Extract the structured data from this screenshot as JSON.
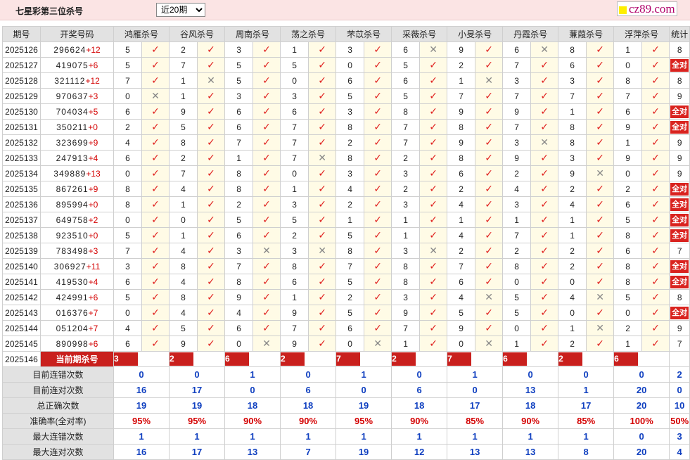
{
  "header": {
    "title": "七星彩第三位杀号",
    "period_selected": "近20期",
    "brand": "cz89.com"
  },
  "table": {
    "col_issue": "期号",
    "col_prize": "开奖号码",
    "col_stats": "统计",
    "experts": [
      "鸿雁杀号",
      "谷风杀号",
      "周南杀号",
      "荡之杀号",
      "芣苡杀号",
      "采薇杀号",
      "小旻杀号",
      "丹霞杀号",
      "蒹葭杀号",
      "浮萍杀号"
    ],
    "rows": [
      {
        "issue": "2025126",
        "prize": "296624",
        "sum": "+12",
        "kills": [
          "5",
          "2",
          "3",
          "1",
          "3",
          "6",
          "9",
          "6",
          "8",
          "1"
        ],
        "ok": [
          1,
          1,
          1,
          1,
          1,
          0,
          1,
          0,
          1,
          1
        ],
        "stat": "8"
      },
      {
        "issue": "2025127",
        "prize": "419075",
        "sum": "+6",
        "kills": [
          "5",
          "7",
          "5",
          "5",
          "0",
          "5",
          "2",
          "7",
          "6",
          "0"
        ],
        "ok": [
          1,
          1,
          1,
          1,
          1,
          1,
          1,
          1,
          1,
          1
        ],
        "stat": "全对"
      },
      {
        "issue": "2025128",
        "prize": "321112",
        "sum": "+12",
        "kills": [
          "7",
          "1",
          "5",
          "0",
          "6",
          "6",
          "1",
          "3",
          "3",
          "8"
        ],
        "ok": [
          1,
          0,
          1,
          1,
          1,
          1,
          0,
          1,
          1,
          1
        ],
        "stat": "8"
      },
      {
        "issue": "2025129",
        "prize": "970637",
        "sum": "+3",
        "kills": [
          "0",
          "1",
          "3",
          "3",
          "5",
          "5",
          "7",
          "7",
          "7",
          "7"
        ],
        "ok": [
          0,
          1,
          1,
          1,
          1,
          1,
          1,
          1,
          1,
          1
        ],
        "stat": "9"
      },
      {
        "issue": "2025130",
        "prize": "704034",
        "sum": "+5",
        "kills": [
          "6",
          "9",
          "6",
          "6",
          "3",
          "8",
          "9",
          "9",
          "1",
          "6"
        ],
        "ok": [
          1,
          1,
          1,
          1,
          1,
          1,
          1,
          1,
          1,
          1
        ],
        "stat": "全对"
      },
      {
        "issue": "2025131",
        "prize": "350211",
        "sum": "+0",
        "kills": [
          "2",
          "5",
          "6",
          "7",
          "8",
          "7",
          "8",
          "7",
          "8",
          "9"
        ],
        "ok": [
          1,
          1,
          1,
          1,
          1,
          1,
          1,
          1,
          1,
          1
        ],
        "stat": "全对"
      },
      {
        "issue": "2025132",
        "prize": "323699",
        "sum": "+9",
        "kills": [
          "4",
          "8",
          "7",
          "7",
          "2",
          "7",
          "9",
          "3",
          "8",
          "1"
        ],
        "ok": [
          1,
          1,
          1,
          1,
          1,
          1,
          1,
          0,
          1,
          1
        ],
        "stat": "9"
      },
      {
        "issue": "2025133",
        "prize": "247913",
        "sum": "+4",
        "kills": [
          "6",
          "2",
          "1",
          "7",
          "8",
          "2",
          "8",
          "9",
          "3",
          "9"
        ],
        "ok": [
          1,
          1,
          1,
          0,
          1,
          1,
          1,
          1,
          1,
          1
        ],
        "stat": "9"
      },
      {
        "issue": "2025134",
        "prize": "349889",
        "sum": "+13",
        "kills": [
          "0",
          "7",
          "8",
          "0",
          "3",
          "3",
          "6",
          "2",
          "9",
          "0"
        ],
        "ok": [
          1,
          1,
          1,
          1,
          1,
          1,
          1,
          1,
          0,
          1
        ],
        "stat": "9"
      },
      {
        "issue": "2025135",
        "prize": "867261",
        "sum": "+9",
        "kills": [
          "8",
          "4",
          "8",
          "1",
          "4",
          "2",
          "2",
          "4",
          "2",
          "2"
        ],
        "ok": [
          1,
          1,
          1,
          1,
          1,
          1,
          1,
          1,
          1,
          1
        ],
        "stat": "全对"
      },
      {
        "issue": "2025136",
        "prize": "895994",
        "sum": "+0",
        "kills": [
          "8",
          "1",
          "2",
          "3",
          "2",
          "3",
          "4",
          "3",
          "4",
          "6"
        ],
        "ok": [
          1,
          1,
          1,
          1,
          1,
          1,
          1,
          1,
          1,
          1
        ],
        "stat": "全对"
      },
      {
        "issue": "2025137",
        "prize": "649758",
        "sum": "+2",
        "kills": [
          "0",
          "0",
          "5",
          "5",
          "1",
          "1",
          "1",
          "1",
          "1",
          "5"
        ],
        "ok": [
          1,
          1,
          1,
          1,
          1,
          1,
          1,
          1,
          1,
          1
        ],
        "stat": "全对"
      },
      {
        "issue": "2025138",
        "prize": "923510",
        "sum": "+0",
        "kills": [
          "5",
          "1",
          "6",
          "2",
          "5",
          "1",
          "4",
          "7",
          "1",
          "8"
        ],
        "ok": [
          1,
          1,
          1,
          1,
          1,
          1,
          1,
          1,
          1,
          1
        ],
        "stat": "全对"
      },
      {
        "issue": "2025139",
        "prize": "783498",
        "sum": "+3",
        "kills": [
          "7",
          "4",
          "3",
          "3",
          "8",
          "3",
          "2",
          "2",
          "2",
          "6"
        ],
        "ok": [
          1,
          1,
          0,
          0,
          1,
          0,
          1,
          1,
          1,
          1
        ],
        "stat": "7"
      },
      {
        "issue": "2025140",
        "prize": "306927",
        "sum": "+11",
        "kills": [
          "3",
          "8",
          "7",
          "8",
          "7",
          "8",
          "7",
          "8",
          "2",
          "8"
        ],
        "ok": [
          1,
          1,
          1,
          1,
          1,
          1,
          1,
          1,
          1,
          1
        ],
        "stat": "全对"
      },
      {
        "issue": "2025141",
        "prize": "419530",
        "sum": "+4",
        "kills": [
          "6",
          "4",
          "8",
          "6",
          "5",
          "8",
          "6",
          "0",
          "0",
          "8"
        ],
        "ok": [
          1,
          1,
          1,
          1,
          1,
          1,
          1,
          1,
          1,
          1
        ],
        "stat": "全对"
      },
      {
        "issue": "2025142",
        "prize": "424991",
        "sum": "+6",
        "kills": [
          "5",
          "8",
          "9",
          "1",
          "2",
          "3",
          "4",
          "5",
          "4",
          "5"
        ],
        "ok": [
          1,
          1,
          1,
          1,
          1,
          1,
          0,
          1,
          0,
          1
        ],
        "stat": "8"
      },
      {
        "issue": "2025143",
        "prize": "016376",
        "sum": "+7",
        "kills": [
          "0",
          "4",
          "4",
          "9",
          "5",
          "9",
          "5",
          "5",
          "0",
          "0"
        ],
        "ok": [
          1,
          1,
          1,
          1,
          1,
          1,
          1,
          1,
          1,
          1
        ],
        "stat": "全对"
      },
      {
        "issue": "2025144",
        "prize": "051204",
        "sum": "+7",
        "kills": [
          "4",
          "5",
          "6",
          "7",
          "6",
          "7",
          "9",
          "0",
          "1",
          "2"
        ],
        "ok": [
          1,
          1,
          1,
          1,
          1,
          1,
          1,
          1,
          0,
          1
        ],
        "stat": "9"
      },
      {
        "issue": "2025145",
        "prize": "890998",
        "sum": "+6",
        "kills": [
          "6",
          "9",
          "0",
          "9",
          "0",
          "1",
          "0",
          "1",
          "2",
          "1"
        ],
        "ok": [
          1,
          1,
          0,
          1,
          0,
          1,
          0,
          1,
          1,
          1
        ],
        "stat": "7"
      }
    ],
    "current": {
      "issue": "2025146",
      "label": "当前期杀号",
      "kills": [
        "3",
        "2",
        "6",
        "2",
        "7",
        "2",
        "7",
        "6",
        "2",
        "6"
      ]
    },
    "stats": [
      {
        "label": "目前连错次数",
        "values": [
          "0",
          "0",
          "1",
          "0",
          "1",
          "0",
          "1",
          "0",
          "0",
          "0"
        ],
        "total": "2"
      },
      {
        "label": "目前连对次数",
        "values": [
          "16",
          "17",
          "0",
          "6",
          "0",
          "6",
          "0",
          "13",
          "1",
          "20"
        ],
        "total": "0"
      },
      {
        "label": "总正确次数",
        "values": [
          "19",
          "19",
          "18",
          "18",
          "19",
          "18",
          "17",
          "18",
          "17",
          "20"
        ],
        "total": "10"
      },
      {
        "label": "准确率(全对率)",
        "values": [
          "95%",
          "95%",
          "90%",
          "90%",
          "95%",
          "90%",
          "85%",
          "90%",
          "85%",
          "100%"
        ],
        "total": "50%"
      },
      {
        "label": "最大连错次数",
        "values": [
          "1",
          "1",
          "1",
          "1",
          "1",
          "1",
          "1",
          "1",
          "1",
          "0"
        ],
        "total": "3"
      },
      {
        "label": "最大连对次数",
        "values": [
          "16",
          "17",
          "13",
          "7",
          "19",
          "12",
          "13",
          "13",
          "8",
          "20"
        ],
        "total": "4"
      }
    ]
  }
}
